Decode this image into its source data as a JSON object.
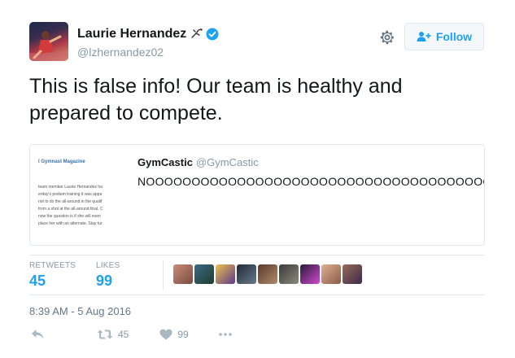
{
  "colors": {
    "accent": "#1da1f2",
    "muted": "#8899a6",
    "text": "#14171a",
    "border": "#e1e8ed"
  },
  "author": {
    "name": "Laurie Hernandez",
    "emoji_icon": "flying-gymnast-emoji",
    "verified_icon": "verified-badge-icon",
    "handle": "@lzhernandez02"
  },
  "follow_button": {
    "label": "Follow",
    "icon": "add-person-icon"
  },
  "settings_icon": "gear-icon",
  "tweet_text": "This is false info! Our team is healthy and prepared to compete.",
  "quoted_tweet": {
    "name": "GymCastic",
    "handle": "@GymCastic",
    "text": "NOOOOOOOOOOOOOOOOOOOOOOOOOOOOOOOOOOOOOO",
    "thumbnail": {
      "title": "l Gymnast Magazine",
      "lines": [
        "team member Laurie Hernandez ha",
        "erday's podium training it was appa",
        "not to do the all-around in the qualif",
        "from a shot at the all-around final. C",
        "now the question is if she will even",
        "place her with an alternate. Stay tur"
      ]
    }
  },
  "stats": {
    "retweets_label": "RETWEETS",
    "retweets_value": "45",
    "likes_label": "LIKES",
    "likes_value": "99"
  },
  "likers_count": 9,
  "timestamp": "8:39 AM - 5 Aug 2016",
  "actions": {
    "reply_icon": "reply-icon",
    "retweet_icon": "retweet-icon",
    "retweet_count": "45",
    "like_icon": "heart-icon",
    "like_count": "99",
    "more_icon": "more-dots-icon"
  }
}
